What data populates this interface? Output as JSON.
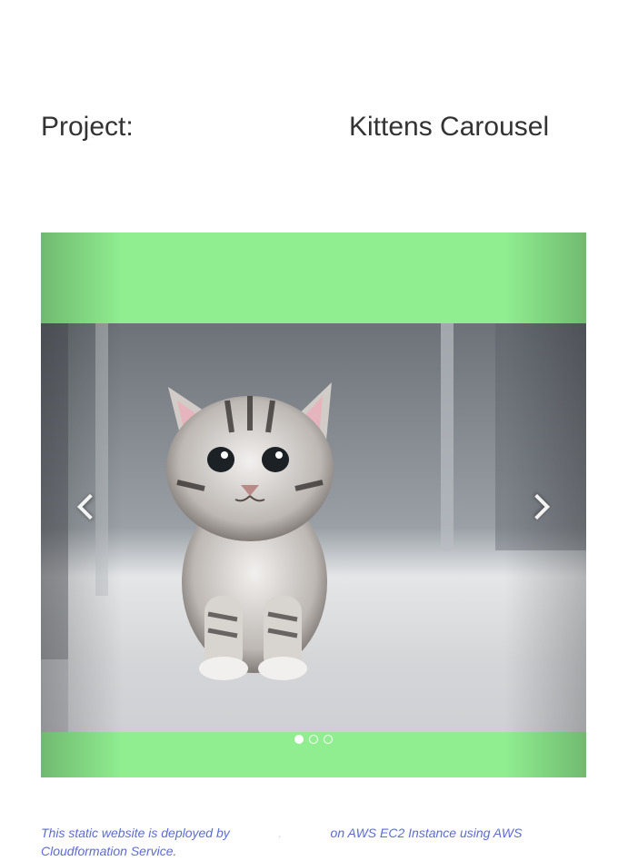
{
  "header": {
    "project_label": "Project:",
    "project_name": "Kittens Carousel"
  },
  "carousel": {
    "prev_label": "Previous",
    "next_label": "Next",
    "active_index": 0,
    "slide_count": 3,
    "background_color": "#90ee90",
    "current_slide_subject": "tabby kitten"
  },
  "footer": {
    "text_part1": "This static website is deployed by",
    "text_gap": ".",
    "text_part2": "on AWS EC2 Instance using AWS Cloudformation Service.",
    "color": "#5c6bd6"
  }
}
